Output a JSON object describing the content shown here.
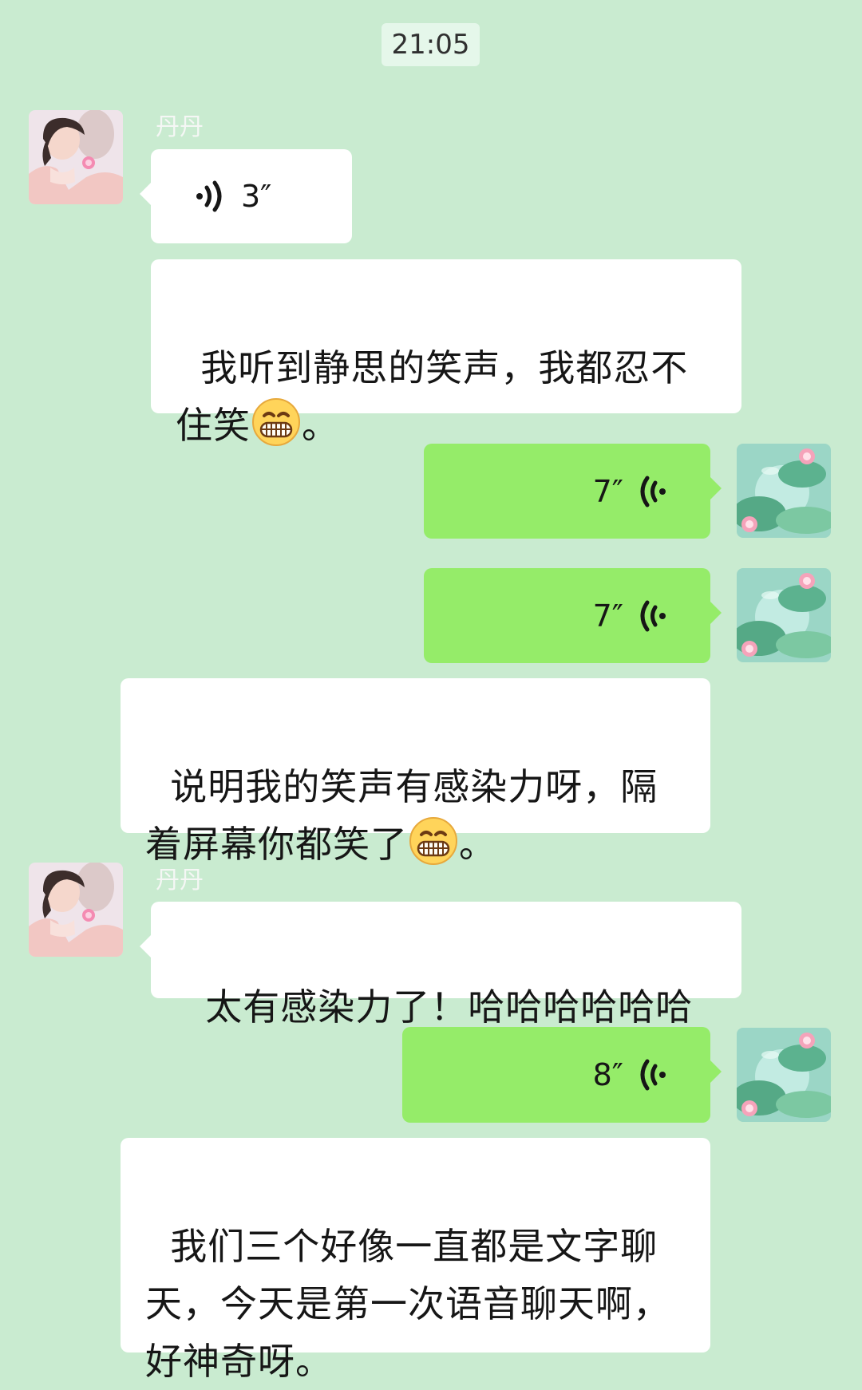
{
  "time": "21:05",
  "colors": {
    "background": "#c9ebd0",
    "outgoing_bubble": "#95ec69",
    "incoming_bubble": "#ffffff",
    "sender_name": "#f5f7f5"
  },
  "messages": [
    {
      "from": "other",
      "sender": "丹丹",
      "type": "voice",
      "duration": "3″",
      "icon": "voice-wave-icon"
    },
    {
      "from": "other",
      "type": "text",
      "text_before": "我听到静思的笑声，我都忍不\n住笑",
      "emoji": "grinning-face-emoji",
      "text_after": "。"
    },
    {
      "from": "self",
      "type": "voice",
      "duration": "7″",
      "icon": "voice-wave-icon"
    },
    {
      "from": "self",
      "type": "voice",
      "duration": "7″",
      "icon": "voice-wave-icon"
    },
    {
      "from": "other",
      "type": "text",
      "text_before": "说明我的笑声有感染力呀，隔\n着屏幕你都笑了",
      "emoji": "grinning-face-emoji",
      "text_after": "。"
    },
    {
      "from": "other",
      "sender": "丹丹",
      "type": "text",
      "text": "太有感染力了！哈哈哈哈哈哈"
    },
    {
      "from": "self",
      "type": "voice",
      "duration": "8″",
      "icon": "voice-wave-icon"
    },
    {
      "from": "other",
      "type": "text",
      "text": "我们三个好像一直都是文字聊\n天，今天是第一次语音聊天啊，\n好神奇呀。"
    }
  ]
}
